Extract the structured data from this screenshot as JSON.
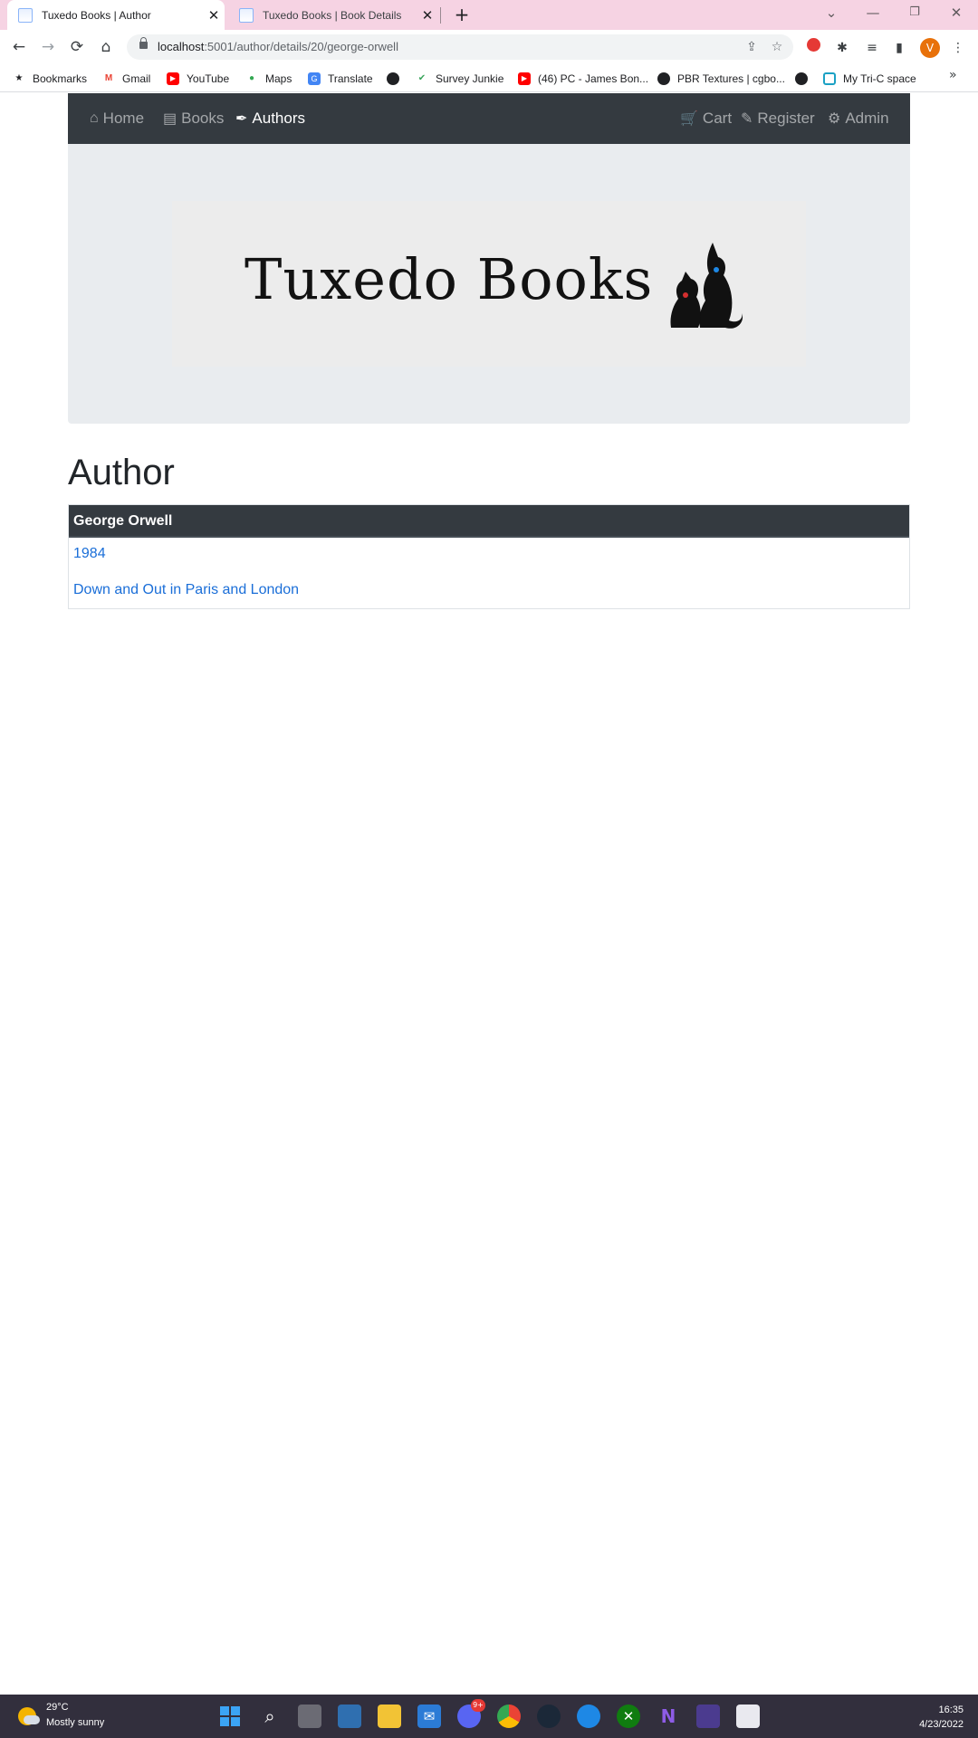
{
  "browser": {
    "tabs": [
      {
        "title": "Tuxedo Books | Author",
        "active": true
      },
      {
        "title": "Tuxedo Books | Book Details",
        "active": false
      }
    ],
    "url_host": "localhost",
    "url_rest": ":5001/author/details/20/george-orwell",
    "profile_initial": "V",
    "bookmarks": [
      "Bookmarks",
      "Gmail",
      "YouTube",
      "Maps",
      "Translate",
      "Survey Junkie",
      "(46) PC - James Bon...",
      "PBR Textures | cgbo...",
      "My Tri-C space"
    ]
  },
  "nav": {
    "home": "Home",
    "books": "Books",
    "authors": "Authors",
    "cart": "Cart",
    "register": "Register",
    "admin": "Admin"
  },
  "banner": {
    "brand": "Tuxedo Books"
  },
  "page": {
    "heading": "Author",
    "author_name": "George Orwell",
    "books": [
      "1984",
      "Down and Out in Paris and London"
    ]
  },
  "taskbar": {
    "temperature": "29°C",
    "weather": "Mostly sunny",
    "time": "16:35",
    "date": "4/23/2022",
    "badge": "9+"
  },
  "colors": {
    "navbar": "#343a40",
    "jumbotron": "#e9ecef",
    "link": "#1a6ed8",
    "tabstrip": "#f6d3e3",
    "taskbar": "#322f3d"
  }
}
